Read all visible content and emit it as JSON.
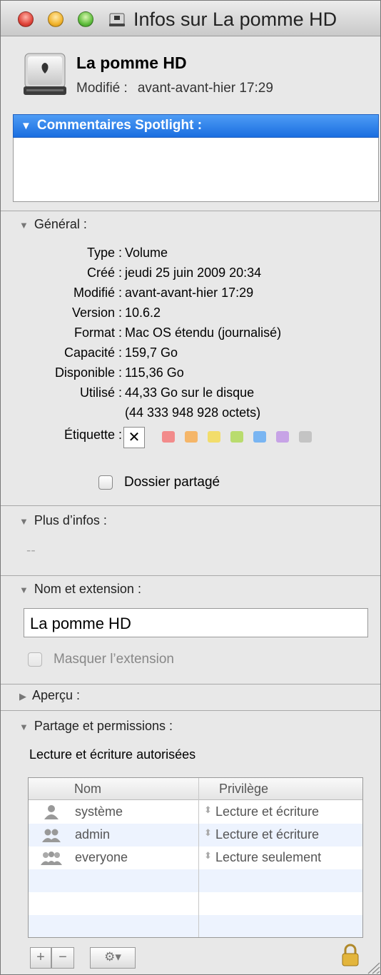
{
  "window": {
    "title": "Infos sur La pomme HD"
  },
  "header": {
    "name": "La pomme HD",
    "modified_label": "Modifié :",
    "modified_value": "avant-avant-hier 17:29"
  },
  "spotlight": {
    "label": "Commentaires Spotlight :"
  },
  "general": {
    "label": "Général :",
    "rows": [
      {
        "key": "Type :",
        "value": "Volume"
      },
      {
        "key": "Créé :",
        "value": "jeudi 25 juin 2009 20:34"
      },
      {
        "key": "Modifié :",
        "value": "avant-avant-hier 17:29"
      },
      {
        "key": "Version :",
        "value": "10.6.2"
      },
      {
        "key": "Format :",
        "value": "Mac OS étendu (journalisé)"
      },
      {
        "key": "Capacité :",
        "value": "159,7 Go"
      },
      {
        "key": "Disponible :",
        "value": "115,36 Go"
      },
      {
        "key": "Utilisé :",
        "value": "44,33 Go sur le disque"
      },
      {
        "key": "",
        "value": "(44 333 948 928 octets)"
      }
    ],
    "label_key": "Étiquette :",
    "label_none": "✕",
    "label_colors": [
      "#f28b8b",
      "#f5b669",
      "#f2dd6b",
      "#b9dc6e",
      "#79b5f2",
      "#c7a3e6",
      "#c4c4c4"
    ],
    "shared_folder": "Dossier partagé"
  },
  "more_info": {
    "label": "Plus d’infos :",
    "value": "--"
  },
  "name_ext": {
    "label": "Nom et extension :",
    "field_value": "La pomme HD",
    "hide_ext": "Masquer l’extension"
  },
  "preview": {
    "label": "Aperçu :"
  },
  "sharing": {
    "label": "Partage et permissions :",
    "status": "Lecture et écriture autorisées",
    "col_name": "Nom",
    "col_priv": "Privilège",
    "rows": [
      {
        "name": "système",
        "priv": "Lecture et écriture",
        "icon": "single-user-icon"
      },
      {
        "name": "admin",
        "priv": "Lecture et écriture",
        "icon": "group-icon"
      },
      {
        "name": "everyone",
        "priv": "Lecture seulement",
        "icon": "everyone-icon"
      }
    ],
    "add": "+",
    "remove": "−",
    "gear": "⚙︎▾"
  }
}
